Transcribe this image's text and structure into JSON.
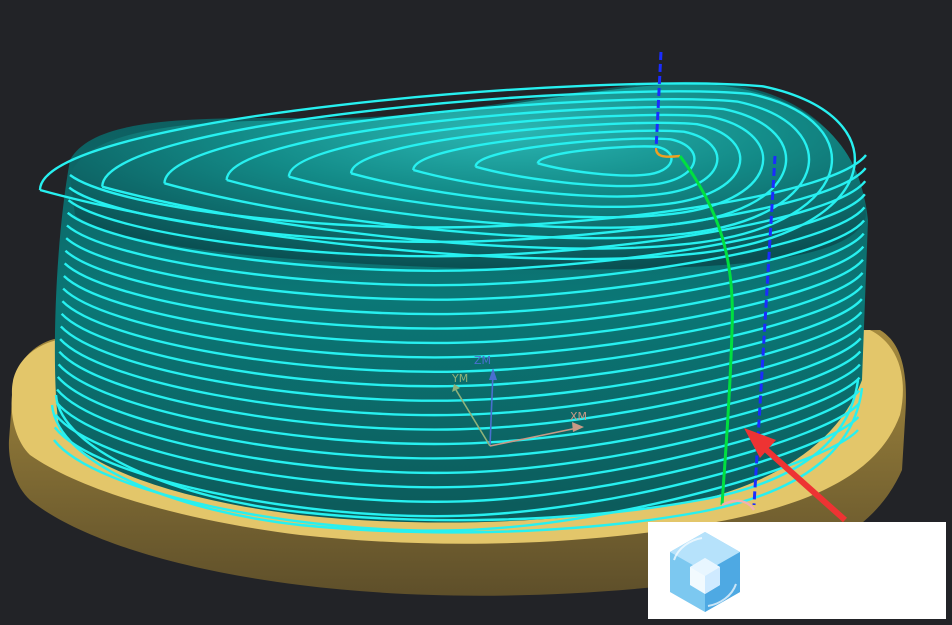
{
  "viewport": {
    "background": "#222327",
    "part_color": "#e3c66a",
    "toolpath_color": "#27f0f0",
    "engage_color": "#00e040",
    "rapid_color": "#1a2cff",
    "arrow_color": "#ee3333"
  },
  "triad": {
    "z_label": "ZM",
    "y_label": "YM",
    "x_label": "XM",
    "z_color": "#4a6fd0",
    "y_color": "#8fb27a",
    "x_color": "#c89a86"
  },
  "watermark": {
    "icon": "cube-logo-icon"
  }
}
